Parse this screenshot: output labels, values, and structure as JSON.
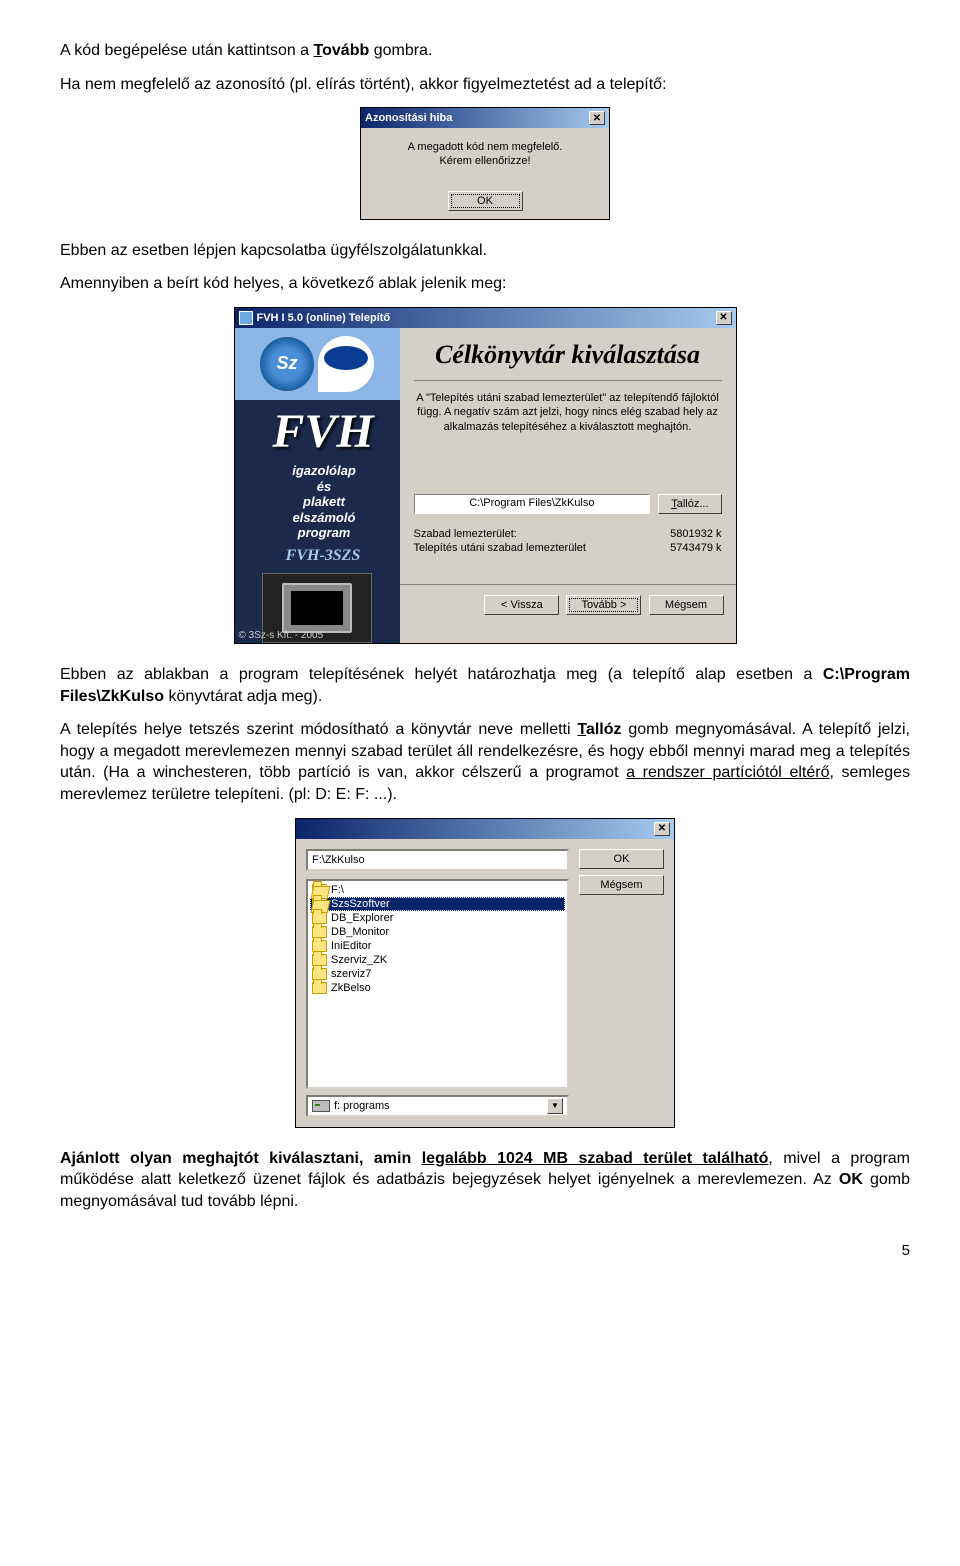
{
  "para1_a": "A kód begépelése után kattintson a ",
  "para1_b": "T",
  "para1_c": "ovább",
  "para1_d": " gombra.",
  "para2": "Ha nem megfelelő az azonosító (pl. elírás történt), akkor figyelmeztetést ad a telepítő:",
  "errDlg": {
    "title": "Azonosítási hiba",
    "line1": "A megadott kód nem megfelelő.",
    "line2": "Kérem ellenőrizze!",
    "ok": "OK"
  },
  "para3": "Ebben az esetben lépjen kapcsolatba ügyfélszolgálatunkkal.",
  "para4": "Amennyiben a beírt kód helyes, a következő ablak jelenik meg:",
  "installer": {
    "title": "FVH I 5.0 (online) Telepítő",
    "side_logo1": "Sz",
    "side_fvh": "FVH",
    "side_l1": "igazolólap",
    "side_l2": "és",
    "side_l3": "plakett",
    "side_l4": "elszámoló",
    "side_l5": "program",
    "side_bottom": "FVH-3SZS",
    "side_tag": "© 3Sz-s Kft. - 2005",
    "heading": "Célkönyvtár kiválasztása",
    "desc": "A \"Telepítés utáni szabad lemezterület\" az telepítendő fájloktól függ. A negatív szám azt jelzi, hogy nincs elég szabad hely az alkalmazás telepítéséhez a kiválasztott meghajtón.",
    "path": "C:\\Program Files\\ZkKulso",
    "browse": "Tallóz...",
    "stat1_label": "Szabad lemezterület:",
    "stat1_val": "5801932 k",
    "stat2_label": "Telepítés utáni szabad lemezterület",
    "stat2_val": "5743479 k",
    "back": "< Vissza",
    "next": "Tovább >",
    "cancel": "Mégsem"
  },
  "para5_a": "Ebben az ablakban a program telepítésének helyét határozhatja meg (a telepítő alap esetben a ",
  "para5_b": "C:\\Program Files\\ZkKulso",
  "para5_c": " könyvtárat adja meg).",
  "para6_a": "A telepítés helye tetszés szerint módosítható a könyvtár neve melletti ",
  "para6_b": "T",
  "para6_c": "allóz",
  "para6_d": " gomb megnyomásával. A telepítő jelzi, hogy a megadott merevlemezen mennyi szabad terület áll rendelkezésre, és hogy ebből mennyi marad meg a telepítés után. (Ha a winchesteren, több partíció is van, akkor célszerű a programot ",
  "para6_e": "a rendszer partíciótól eltérő",
  "para6_f": ", semleges merevlemez területre telepíteni. (pl: D: E: F: ...).",
  "browse": {
    "path": "F:\\ZkKulso",
    "ok": "OK",
    "cancel": "Mégsem",
    "items": [
      "F:\\",
      "SzsSzoftver",
      "DB_Explorer",
      "DB_Monitor",
      "IniEditor",
      "Szerviz_ZK",
      "szerviz7",
      "ZkBelso"
    ],
    "drive": "f: programs"
  },
  "para7_a": "Ajánlott olyan meghajtót kiválasztani, amin ",
  "para7_b": "legalább 1024 MB szabad terület található",
  "para7_c": ", mivel a program működése alatt keletkező üzenet fájlok és adatbázis bejegyzések helyet igényelnek a merevlemezen. Az ",
  "para7_d": "OK",
  "para7_e": " gomb megnyomásával tud tovább lépni.",
  "pagenum": "5"
}
